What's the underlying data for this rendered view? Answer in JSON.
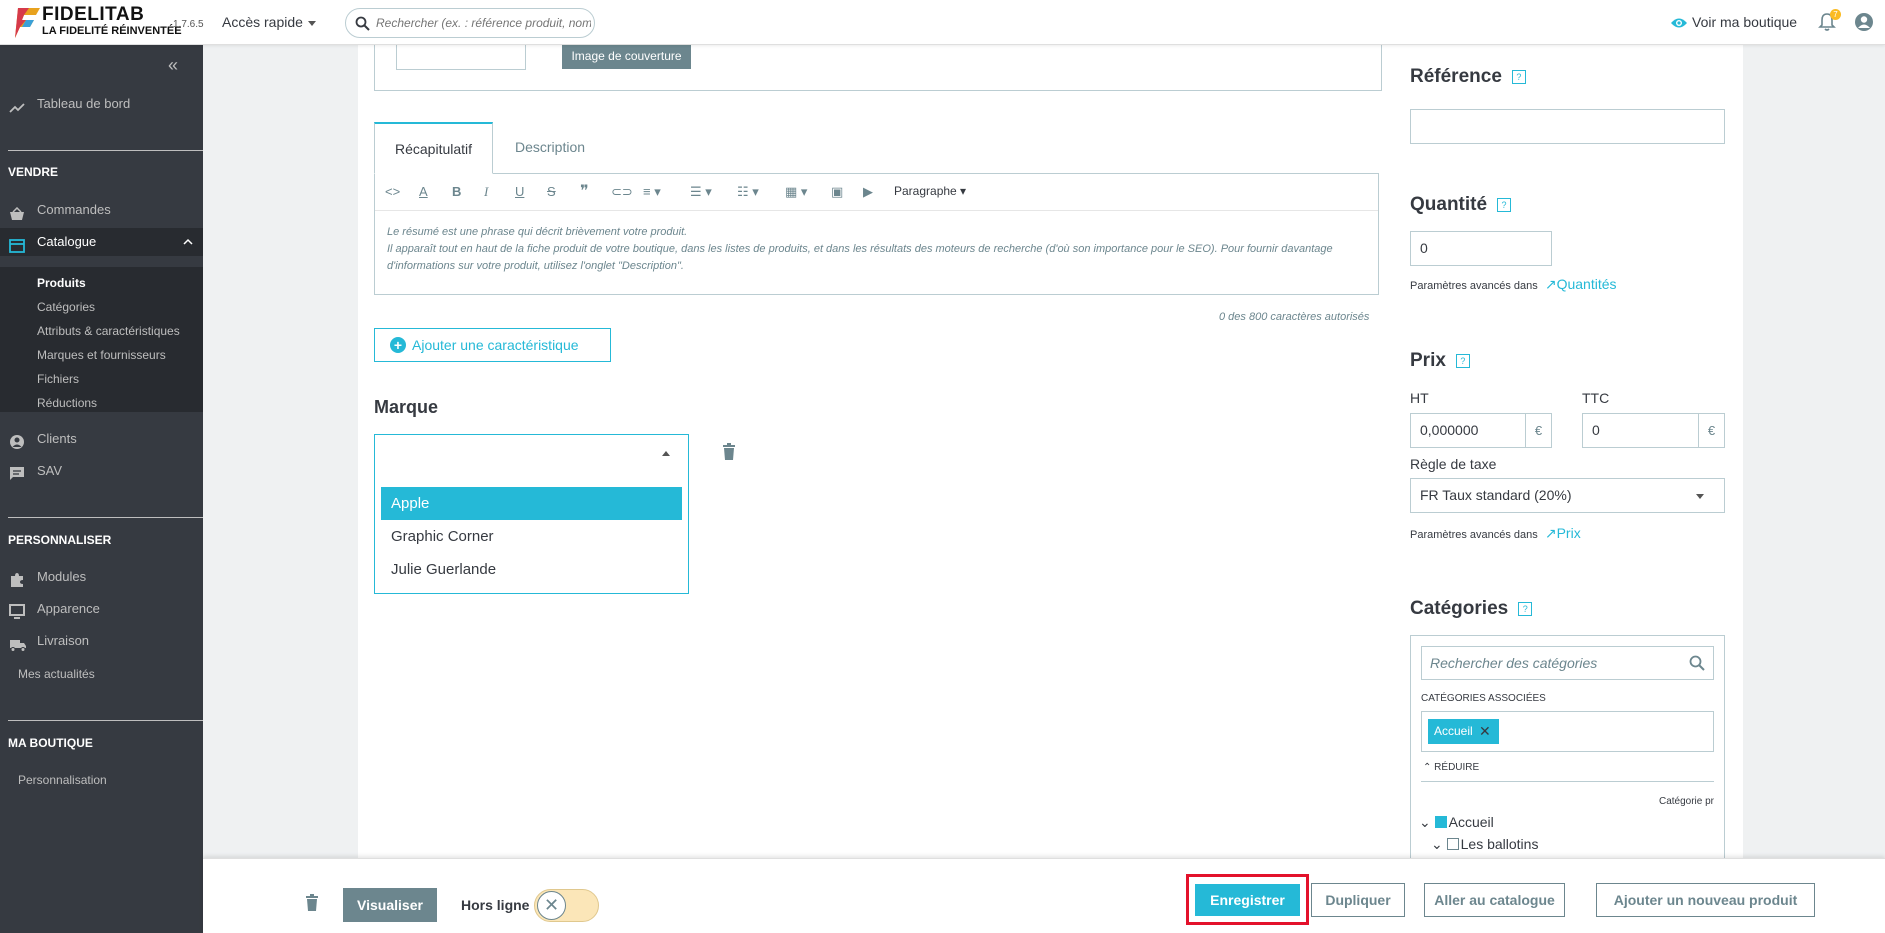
{
  "header": {
    "brand_name": "FIDELITAB",
    "brand_tagline": "LA FIDELITÉ RÉINVENTÉE",
    "version": "1.7.6.5",
    "quick_access": "Accès rapide",
    "search_placeholder": "Rechercher (ex. : référence produit, nom",
    "view_shop": "Voir ma boutique",
    "notifications_count": "7"
  },
  "sidebar": {
    "dashboard": "Tableau de bord",
    "section_sell": "VENDRE",
    "orders": "Commandes",
    "catalog": "Catalogue",
    "catalog_sub": [
      "Produits",
      "Catégories",
      "Attributs & caractéristiques",
      "Marques et fournisseurs",
      "Fichiers",
      "Réductions"
    ],
    "customers": "Clients",
    "sav": "SAV",
    "section_customize": "PERSONNALISER",
    "modules": "Modules",
    "appearance": "Apparence",
    "shipping": "Livraison",
    "news": "Mes actualités",
    "section_shop": "MA BOUTIQUE",
    "personalization": "Personnalisation"
  },
  "main": {
    "cover_label": "Image de couverture",
    "tabs": [
      "Récapitulatif",
      "Description"
    ],
    "editor_paragraph": "Paragraphe",
    "editor_text_1": "Le résumé est une phrase qui décrit brièvement votre produit.",
    "editor_text_2": "Il apparaît tout en haut de la fiche produit de votre boutique, dans les listes de produits, et dans les résultats des moteurs de recherche (d'où son importance pour le SEO). Pour fournir davantage d'informations sur votre produit, utilisez l'onglet \"Description\".",
    "char_count": "0 des 800 caractères autorisés",
    "add_feature": "Ajouter une caractéristique",
    "brand_heading": "Marque",
    "brand_options": [
      "Apple",
      "Graphic Corner",
      "Julie Guerlande"
    ]
  },
  "right": {
    "reference_heading": "Référence",
    "reference_value": "",
    "quantity_heading": "Quantité",
    "quantity_value": "0",
    "advanced_params": "Paramètres avancés dans",
    "quantities_link": "Quantités",
    "price_heading": "Prix",
    "ht_label": "HT",
    "ttc_label": "TTC",
    "ht_value": "0,000000",
    "ttc_value": "0",
    "currency": "€",
    "tax_rule_label": "Règle de taxe",
    "tax_rule_value": "FR Taux standard (20%)",
    "price_link": "Prix",
    "categories_heading": "Catégories",
    "categories_search": "Rechercher des catégories",
    "assoc_label": "CATÉGORIES ASSOCIÉES",
    "assoc_tag": "Accueil",
    "reduce": "RÉDUIRE",
    "main_cat_label": "Catégorie pr",
    "tree": [
      "Accueil",
      "Les ballotins"
    ]
  },
  "footer": {
    "preview": "Visualiser",
    "offline": "Hors ligne",
    "save": "Enregistrer",
    "duplicate": "Dupliquer",
    "go_catalog": "Aller au catalogue",
    "add_product": "Ajouter un nouveau produit"
  },
  "colors": {
    "accent": "#25b9d7",
    "sidebar_bg": "#363a41",
    "highlight_border": "#e3112b"
  }
}
